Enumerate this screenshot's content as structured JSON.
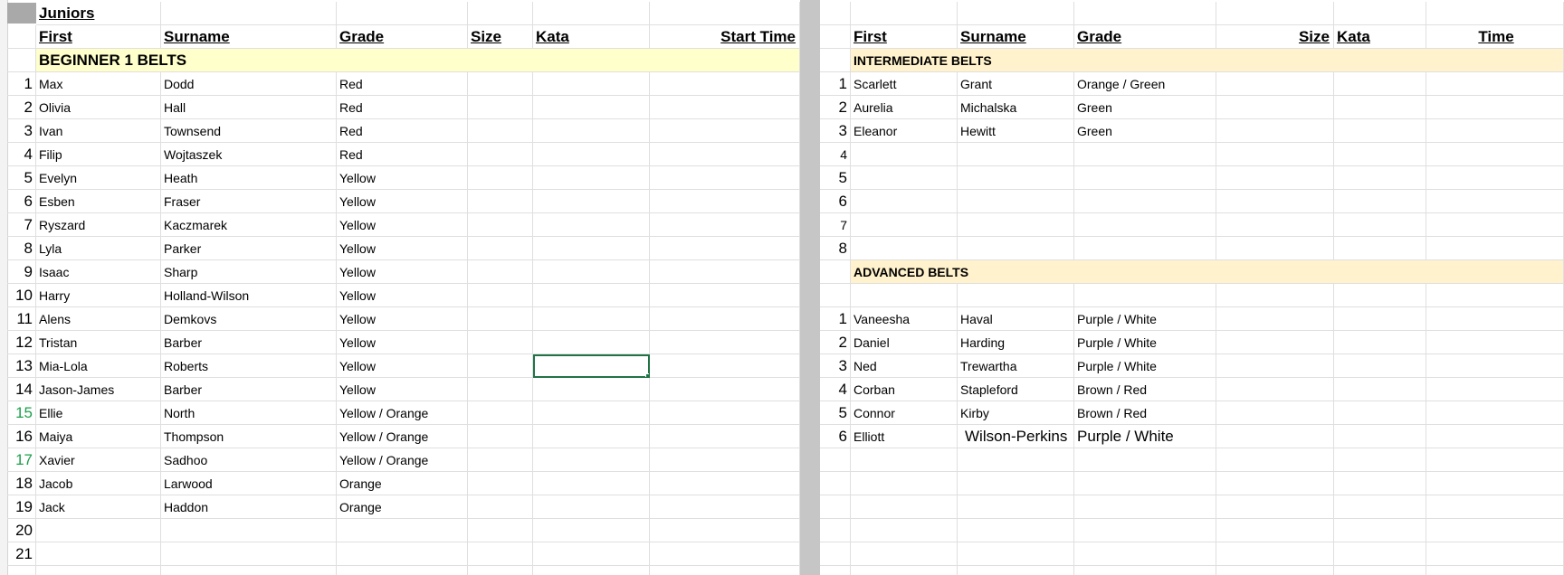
{
  "left": {
    "title": "Juniors",
    "headers": {
      "first": "First",
      "surname": "Surname",
      "grade": "Grade",
      "size": "Size",
      "kata": "Kata",
      "time": "Start Time"
    },
    "section": "BEGINNER 1 BELTS",
    "rows": [
      {
        "n": "1",
        "first": "Max",
        "surname": "Dodd",
        "grade": "Red"
      },
      {
        "n": "2",
        "first": "Olivia",
        "surname": "Hall",
        "grade": "Red"
      },
      {
        "n": "3",
        "first": "Ivan",
        "surname": "Townsend",
        "grade": "Red"
      },
      {
        "n": "4",
        "first": "Filip",
        "surname": "Wojtaszek",
        "grade": "Red"
      },
      {
        "n": "5",
        "first": "Evelyn",
        "surname": "Heath",
        "grade": "Yellow"
      },
      {
        "n": "6",
        "first": "Esben",
        "surname": "Fraser",
        "grade": "Yellow"
      },
      {
        "n": "7",
        "first": "Ryszard",
        "surname": "Kaczmarek",
        "grade": "Yellow"
      },
      {
        "n": "8",
        "first": "Lyla",
        "surname": "Parker",
        "grade": "Yellow"
      },
      {
        "n": "9",
        "first": "Isaac",
        "surname": "Sharp",
        "grade": "Yellow"
      },
      {
        "n": "10",
        "first": "Harry",
        "surname": "Holland-Wilson",
        "grade": "Yellow"
      },
      {
        "n": "11",
        "first": "Alens",
        "surname": "Demkovs",
        "grade": "Yellow"
      },
      {
        "n": "12",
        "first": "Tristan",
        "surname": "Barber",
        "grade": "Yellow"
      },
      {
        "n": "13",
        "first": "Mia-Lola",
        "surname": "Roberts",
        "grade": "Yellow"
      },
      {
        "n": "14",
        "first": "Jason-James",
        "surname": "Barber",
        "grade": "Yellow"
      },
      {
        "n": "15",
        "first": "Ellie",
        "surname": "North",
        "grade": "Yellow / Orange"
      },
      {
        "n": "16",
        "first": "Maiya",
        "surname": "Thompson",
        "grade": "Yellow / Orange"
      },
      {
        "n": "17",
        "first": "Xavier",
        "surname": "Sadhoo",
        "grade": "Yellow / Orange"
      },
      {
        "n": "18",
        "first": "Jacob",
        "surname": "Larwood",
        "grade": "Orange"
      },
      {
        "n": "19",
        "first": "Jack",
        "surname": "Haddon",
        "grade": "Orange"
      },
      {
        "n": "20",
        "first": "",
        "surname": "",
        "grade": ""
      },
      {
        "n": "21",
        "first": "",
        "surname": "",
        "grade": ""
      }
    ]
  },
  "right": {
    "headers": {
      "first": "First",
      "surname": "Surname",
      "grade": "Grade",
      "size": "Size",
      "kata": "Kata",
      "time": "Time"
    },
    "section1": "INTERMEDIATE BELTS",
    "rows1": [
      {
        "n": "1",
        "first": "Scarlett",
        "surname": "Grant",
        "grade": "Orange / Green"
      },
      {
        "n": "2",
        "first": "Aurelia",
        "surname": "Michalska",
        "grade": "Green"
      },
      {
        "n": "3",
        "first": "Eleanor",
        "surname": "Hewitt",
        "grade": "Green"
      },
      {
        "n": "4",
        "first": "",
        "surname": "",
        "grade": ""
      },
      {
        "n": "5",
        "first": "",
        "surname": "",
        "grade": ""
      },
      {
        "n": "6",
        "first": "",
        "surname": "",
        "grade": ""
      },
      {
        "n": "7",
        "first": "",
        "surname": "",
        "grade": ""
      },
      {
        "n": "8",
        "first": "",
        "surname": "",
        "grade": ""
      }
    ],
    "section2": "ADVANCED BELTS",
    "rows2": [
      {
        "n": "1",
        "first": "Vaneesha",
        "surname": "Haval",
        "grade": "Purple / White"
      },
      {
        "n": "2",
        "first": "Daniel",
        "surname": "Harding",
        "grade": "Purple / White"
      },
      {
        "n": "3",
        "first": "Ned",
        "surname": "Trewartha",
        "grade": "Purple / White"
      },
      {
        "n": "4",
        "first": "Corban",
        "surname": "Stapleford",
        "grade": "Brown / Red"
      },
      {
        "n": "5",
        "first": "Connor",
        "surname": "Kirby",
        "grade": "Brown / Red"
      },
      {
        "n": "6",
        "first": "Elliott",
        "surname": "Wilson-Perkins",
        "grade": "Purple / White"
      }
    ]
  },
  "colors": {
    "section_fill": "#fff2cc",
    "section_fill_left": "#ffffcc",
    "selection": "#217346",
    "row_num_green": "#1a9f4a"
  }
}
